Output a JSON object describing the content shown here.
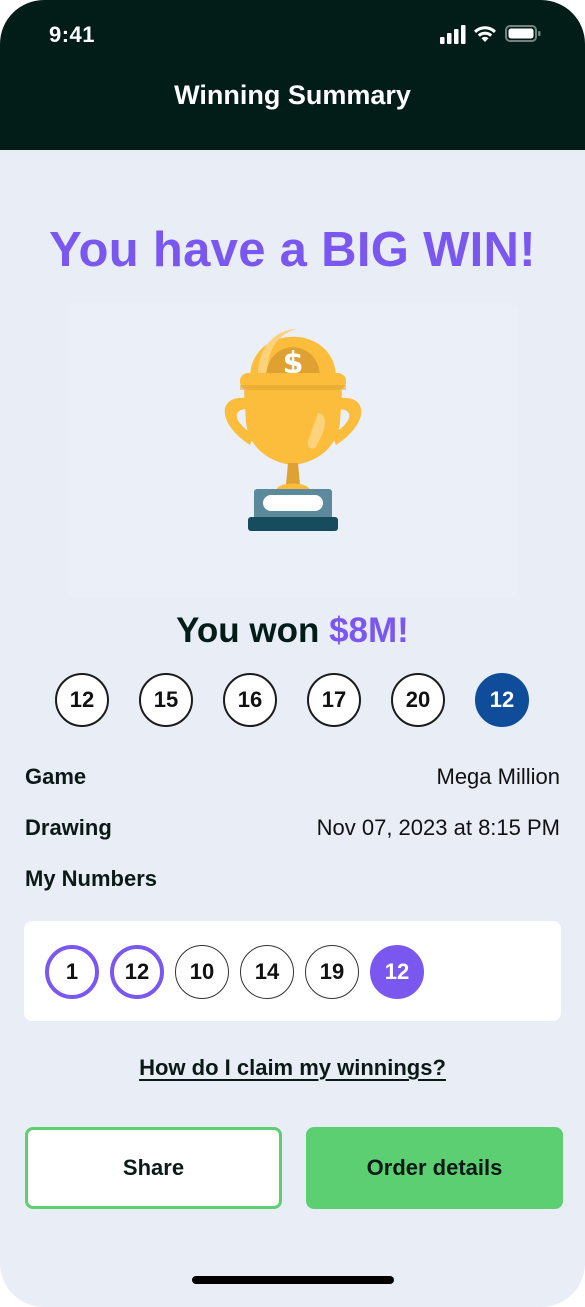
{
  "status_bar": {
    "time": "9:41"
  },
  "header": {
    "title": "Winning Summary"
  },
  "headline": "You have a BIG WIN!",
  "prize": {
    "prefix": "You won ",
    "amount": "$8M!"
  },
  "winning_numbers": [
    "12",
    "15",
    "16",
    "17",
    "20"
  ],
  "winning_bonus": "12",
  "details": {
    "game_label": "Game",
    "game_value": "Mega Million",
    "drawing_label": "Drawing",
    "drawing_value": "Nov 07, 2023 at 8:15 PM",
    "my_numbers_label": "My Numbers"
  },
  "my_numbers": [
    {
      "value": "1",
      "matched": true
    },
    {
      "value": "12",
      "matched": true
    },
    {
      "value": "10",
      "matched": false
    },
    {
      "value": "14",
      "matched": false
    },
    {
      "value": "19",
      "matched": false
    }
  ],
  "my_bonus": "12",
  "claim_link": "How do I claim my winnings?",
  "buttons": {
    "share": "Share",
    "order": "Order details"
  },
  "icons": [
    "signal-icon",
    "wifi-icon",
    "battery-icon",
    "trophy-icon"
  ],
  "colors": {
    "header": "#021c18",
    "accent_purple": "#7a58f0",
    "bonus_blue": "#0f4c99",
    "button_green": "#5bcf72",
    "background": "#e8edf6"
  }
}
